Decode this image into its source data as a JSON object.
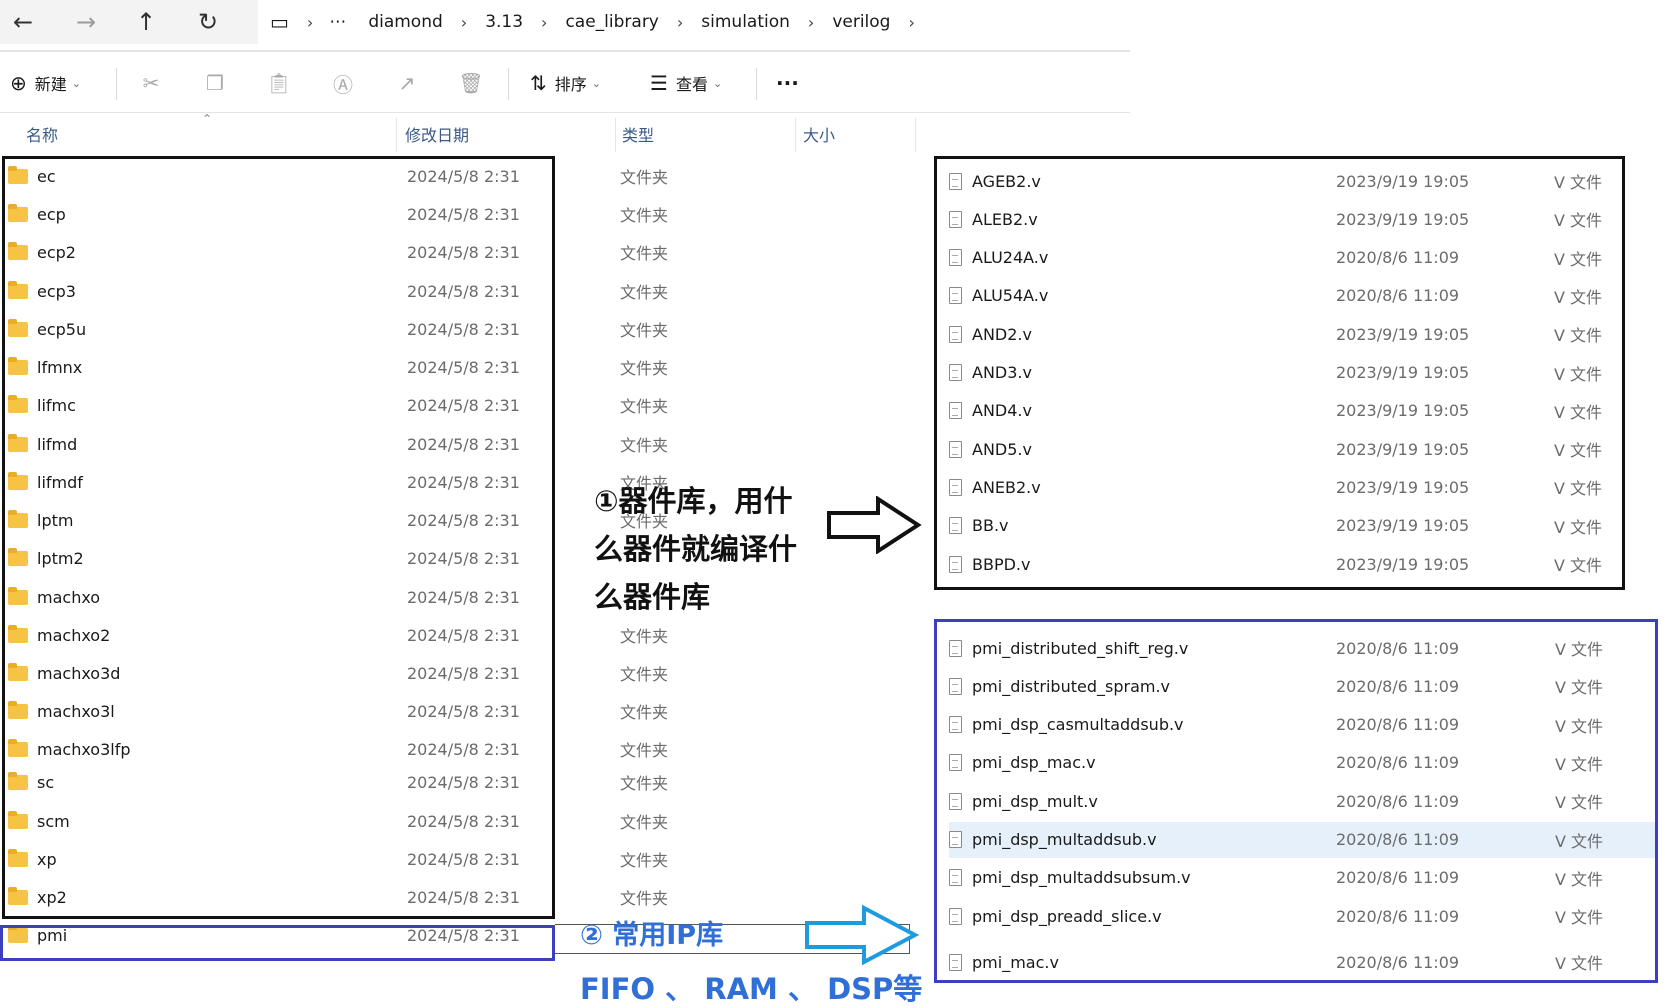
{
  "nav": {
    "back_icon": "←",
    "forward_icon": "→",
    "up_icon": "↑",
    "refresh_icon": "↻",
    "computer_icon": "▭",
    "more_icon": "⋯"
  },
  "breadcrumb": [
    "diamond",
    "3.13",
    "cae_library",
    "simulation",
    "verilog"
  ],
  "toolbar": {
    "new_label": "新建",
    "sort_label": "排序",
    "view_label": "查看",
    "more_label": "···"
  },
  "columns": {
    "name": "名称",
    "modified": "修改日期",
    "type": "类型",
    "size": "大小"
  },
  "folders": [
    {
      "name": "ec",
      "date": "2024/5/8 2:31",
      "type": "文件夹"
    },
    {
      "name": "ecp",
      "date": "2024/5/8 2:31",
      "type": "文件夹"
    },
    {
      "name": "ecp2",
      "date": "2024/5/8 2:31",
      "type": "文件夹"
    },
    {
      "name": "ecp3",
      "date": "2024/5/8 2:31",
      "type": "文件夹"
    },
    {
      "name": "ecp5u",
      "date": "2024/5/8 2:31",
      "type": "文件夹"
    },
    {
      "name": "lfmnx",
      "date": "2024/5/8 2:31",
      "type": "文件夹"
    },
    {
      "name": "lifmc",
      "date": "2024/5/8 2:31",
      "type": "文件夹"
    },
    {
      "name": "lifmd",
      "date": "2024/5/8 2:31",
      "type": "文件夹"
    },
    {
      "name": "lifmdf",
      "date": "2024/5/8 2:31",
      "type": "文件夹"
    },
    {
      "name": "lptm",
      "date": "2024/5/8 2:31",
      "type": "文件夹"
    },
    {
      "name": "lptm2",
      "date": "2024/5/8 2:31",
      "type": ""
    },
    {
      "name": "machxo",
      "date": "2024/5/8 2:31",
      "type": ""
    },
    {
      "name": "machxo2",
      "date": "2024/5/8 2:31",
      "type": "文件夹"
    },
    {
      "name": "machxo3d",
      "date": "2024/5/8 2:31",
      "type": "文件夹"
    },
    {
      "name": "machxo3l",
      "date": "2024/5/8 2:31",
      "type": "文件夹"
    },
    {
      "name": "machxo3lfp",
      "date": "2024/5/8 2:31",
      "type": "文件夹"
    },
    {
      "name": "sc",
      "date": "2024/5/8 2:31",
      "type": "文件夹"
    },
    {
      "name": "scm",
      "date": "2024/5/8 2:31",
      "type": "文件夹"
    },
    {
      "name": "xp",
      "date": "2024/5/8 2:31",
      "type": "文件夹"
    },
    {
      "name": "xp2",
      "date": "2024/5/8 2:31",
      "type": "文件夹"
    },
    {
      "name": "pmi",
      "date": "2024/5/8 2:31",
      "type": ""
    }
  ],
  "device_files": [
    {
      "name": "AGEB2.v",
      "date": "2023/9/19 19:05",
      "type": "V 文件"
    },
    {
      "name": "ALEB2.v",
      "date": "2023/9/19 19:05",
      "type": "V 文件"
    },
    {
      "name": "ALU24A.v",
      "date": "2020/8/6 11:09",
      "type": "V 文件"
    },
    {
      "name": "ALU54A.v",
      "date": "2020/8/6 11:09",
      "type": "V 文件"
    },
    {
      "name": "AND2.v",
      "date": "2023/9/19 19:05",
      "type": "V 文件"
    },
    {
      "name": "AND3.v",
      "date": "2023/9/19 19:05",
      "type": "V 文件"
    },
    {
      "name": "AND4.v",
      "date": "2023/9/19 19:05",
      "type": "V 文件"
    },
    {
      "name": "AND5.v",
      "date": "2023/9/19 19:05",
      "type": "V 文件"
    },
    {
      "name": "ANEB2.v",
      "date": "2023/9/19 19:05",
      "type": "V 文件"
    },
    {
      "name": "BB.v",
      "date": "2023/9/19 19:05",
      "type": "V 文件"
    },
    {
      "name": "BBPD.v",
      "date": "2023/9/19 19:05",
      "type": "V 文件"
    }
  ],
  "pmi_files": [
    {
      "name": "pmi_distributed_shift_reg.v",
      "date": "2020/8/6 11:09",
      "type": "V 文件"
    },
    {
      "name": "pmi_distributed_spram.v",
      "date": "2020/8/6 11:09",
      "type": "V 文件"
    },
    {
      "name": "pmi_dsp_casmultaddsub.v",
      "date": "2020/8/6 11:09",
      "type": "V 文件"
    },
    {
      "name": "pmi_dsp_mac.v",
      "date": "2020/8/6 11:09",
      "type": "V 文件"
    },
    {
      "name": "pmi_dsp_mult.v",
      "date": "2020/8/6 11:09",
      "type": "V 文件"
    },
    {
      "name": "pmi_dsp_multaddsub.v",
      "date": "2020/8/6 11:09",
      "type": "V 文件"
    },
    {
      "name": "pmi_dsp_multaddsubsum.v",
      "date": "2020/8/6 11:09",
      "type": "V 文件"
    },
    {
      "name": "pmi_dsp_preadd_slice.v",
      "date": "2020/8/6 11:09",
      "type": "V 文件"
    },
    {
      "name": "pmi_mac.v",
      "date": "2020/8/6 11:09",
      "type": "V 文件"
    }
  ],
  "pmi_selected_index": 5,
  "annotations": {
    "device_lib_lines": [
      "①器件库，用什",
      "么器件就编译什",
      "么器件库"
    ],
    "ip_lib_title": "② 常用IP库",
    "ip_lib_sub": "FIFO 、 RAM 、 DSP等"
  },
  "colors": {
    "black_box": "#111111",
    "blue_box": "#3d3fc0",
    "arrow_blue": "#1e9be0",
    "folder": "#f6c344",
    "selected_row": "#e5f0fb",
    "header_text": "#3b5a8a"
  }
}
